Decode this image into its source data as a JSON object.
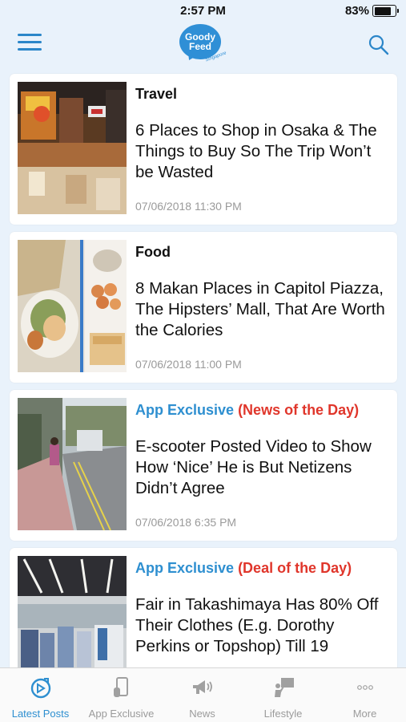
{
  "status_bar": {
    "time": "2:57 PM",
    "battery_percent": "83%",
    "battery_level": 0.83
  },
  "header": {
    "menu_icon": "hamburger-menu-icon",
    "logo": {
      "line1": "Goody",
      "line2": "Feed",
      "tag": "Singapore"
    },
    "search_icon": "search-icon",
    "accent_color": "#2e8fd0"
  },
  "feed": {
    "posts": [
      {
        "category": "Travel",
        "title": "6 Places to Shop in Osaka & The Things to Buy So The Trip Won’t be Wasted",
        "date": "07/06/2018 11:30 PM"
      },
      {
        "category": "Food",
        "title": "8 Makan Places in Capitol Piazza, The Hipsters’ Mall, That Are Worth the Calories",
        "date": "07/06/2018 11:00 PM"
      },
      {
        "category": "App Exclusive",
        "category_tag": "(News of the Day)",
        "title": "E-scooter Posted Video to Show How ‘Nice’ He is But Netizens Didn’t Agree",
        "date": "07/06/2018 6:35 PM"
      },
      {
        "category": "App Exclusive",
        "category_tag": "(Deal of the Day)",
        "title": "Fair in Takashimaya Has 80% Off Their Clothes (E.g. Dorothy Perkins or Topshop) Till 19",
        "date": ""
      }
    ]
  },
  "tab_bar": {
    "tabs": [
      {
        "label": "Latest Posts",
        "icon": "latest-posts-icon",
        "active": true
      },
      {
        "label": "App Exclusive",
        "icon": "phone-icon",
        "active": false
      },
      {
        "label": "News",
        "icon": "megaphone-icon",
        "active": false
      },
      {
        "label": "Lifestyle",
        "icon": "presenter-icon",
        "active": false
      },
      {
        "label": "More",
        "icon": "more-dots-icon",
        "active": false
      }
    ]
  }
}
